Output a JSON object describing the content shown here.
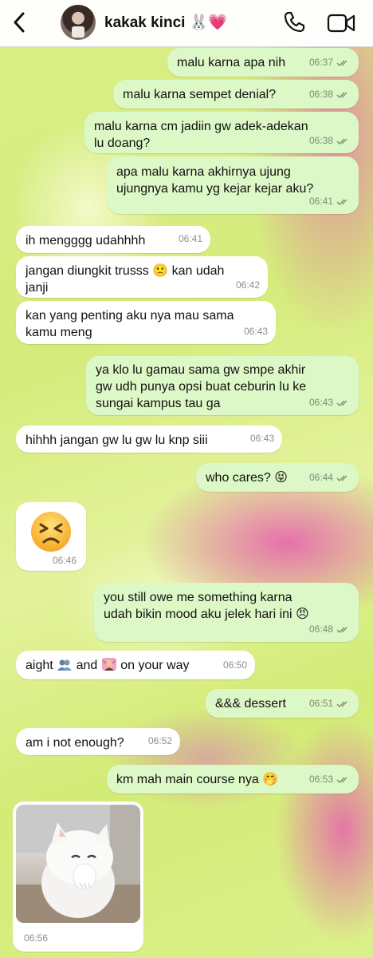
{
  "header": {
    "contact_name": "kakak kinci 🐰💗",
    "icons": [
      "back-chevron-icon",
      "avatar",
      "phone-icon",
      "video-camera-icon"
    ]
  },
  "messages": [
    {
      "dir": "out",
      "text": "malu karna apa nih",
      "time": "06:37",
      "ticks": "read"
    },
    {
      "dir": "out",
      "text": "malu karna sempet denial?",
      "time": "06:38",
      "ticks": "read"
    },
    {
      "dir": "out",
      "text": "malu karna cm jadiin gw adek-adekan\nlu doang?",
      "time": "06:38",
      "ticks": "read"
    },
    {
      "dir": "out",
      "text": "apa malu karna akhirnya ujung\nujungnya kamu yg kejar kejar aku?",
      "time": "06:41",
      "ticks": "read"
    },
    {
      "dir": "in",
      "text": "ih mengggg udahhhh",
      "time": "06:41"
    },
    {
      "dir": "in",
      "text": "jangan diungkit trusss 🙁 kan udah\njanji",
      "time": "06:42"
    },
    {
      "dir": "in",
      "text": "kan yang penting aku nya mau sama\nkamu meng",
      "time": "06:43"
    },
    {
      "dir": "out",
      "text": "ya klo lu gamau sama gw smpe akhir\ngw udh punya opsi buat ceburin lu ke\nsungai kampus tau ga",
      "time": "06:43",
      "ticks": "read"
    },
    {
      "dir": "in",
      "text": "hihhh jangan gw lu gw lu knp siii",
      "time": "06:43"
    },
    {
      "dir": "out",
      "text": "who cares? 😝",
      "time": "06:44",
      "ticks": "read"
    },
    {
      "dir": "in",
      "emoji": "😣",
      "time": "06:46"
    },
    {
      "dir": "out",
      "text": "you still owe me something karna\nudah bikin mood aku jelek hari ini 😠",
      "time": "06:48",
      "ticks": "read"
    },
    {
      "dir": "in",
      "text_parts": [
        "aight",
        "and",
        "on your way"
      ],
      "emojis": [
        "👥",
        "💆"
      ],
      "time": "06:50"
    },
    {
      "dir": "out",
      "text": "&&& dessert",
      "time": "06:51",
      "ticks": "read"
    },
    {
      "dir": "in",
      "text": "am i not enough?",
      "time": "06:52"
    },
    {
      "dir": "out",
      "text": "km mah main course nya 🤭",
      "time": "06:53",
      "ticks": "read"
    },
    {
      "dir": "in",
      "image": "white-kitten-photo",
      "time": "06:56"
    }
  ],
  "colors": {
    "outgoing_bubble": "#dcf8c6",
    "incoming_bubble": "#ffffff",
    "read_ticks": "#7d8a76",
    "wallpaper_green": "#d9ee86",
    "wallpaper_pink": "#e846b4"
  }
}
